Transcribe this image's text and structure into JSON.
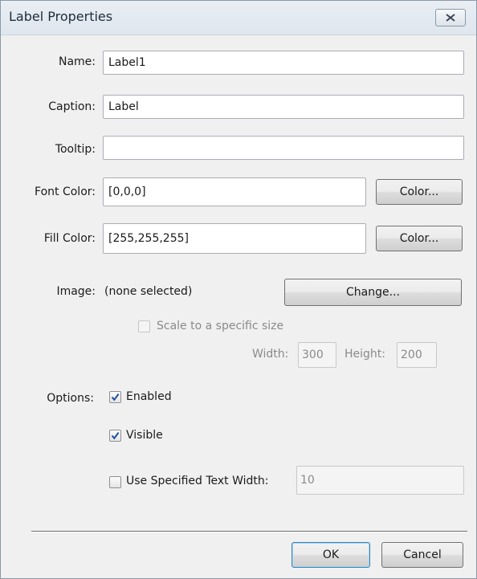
{
  "window": {
    "title": "Label Properties",
    "close_icon": "close-icon"
  },
  "fields": {
    "name": {
      "label": "Name:",
      "value": "Label1"
    },
    "caption": {
      "label": "Caption:",
      "value": "Label"
    },
    "tooltip": {
      "label": "Tooltip:",
      "value": ""
    },
    "font_color": {
      "label": "Font Color:",
      "value": "[0,0,0]",
      "button": "Color..."
    },
    "fill_color": {
      "label": "Fill Color:",
      "value": "[255,255,255]",
      "button": "Color..."
    }
  },
  "image": {
    "label": "Image:",
    "value": "(none selected)",
    "change_button": "Change...",
    "scale_checkbox": {
      "label": "Scale to a specific size",
      "checked": false,
      "enabled": false
    },
    "width": {
      "label": "Width:",
      "value": "300"
    },
    "height": {
      "label": "Height:",
      "value": "200"
    }
  },
  "options": {
    "label": "Options:",
    "enabled": {
      "label": "Enabled",
      "checked": true
    },
    "visible": {
      "label": "Visible",
      "checked": true
    },
    "text_width": {
      "label": "Use Specified Text Width:",
      "checked": false,
      "value": "10"
    }
  },
  "footer": {
    "ok": "OK",
    "cancel": "Cancel"
  },
  "colors": {
    "check_accent": "#1c4fa0",
    "primary_button_border": "#3c7fb1",
    "dialog_background": "#f0f0f0"
  }
}
